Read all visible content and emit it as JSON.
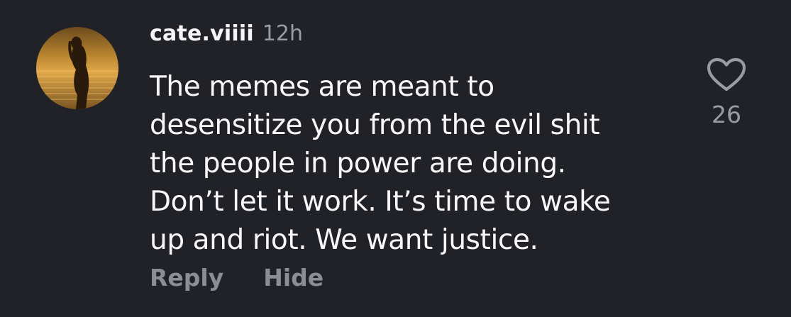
{
  "comment": {
    "username": "cate.viiii",
    "timestamp": "12h",
    "text_lines": [
      "The memes are meant to",
      "desensitize you from the evil shit",
      "the people in power are doing.",
      "Don’t let it work. It’s time to wake",
      "up and riot. We want justice."
    ],
    "reply_label": "Reply",
    "hide_label": "Hide",
    "like_count": "26",
    "like_icon": "heart-outline-icon"
  },
  "colors": {
    "background": "#212228",
    "text_primary": "#f5f5f5",
    "text_secondary": "#9a9ca4",
    "action_text": "#8c8e95"
  }
}
